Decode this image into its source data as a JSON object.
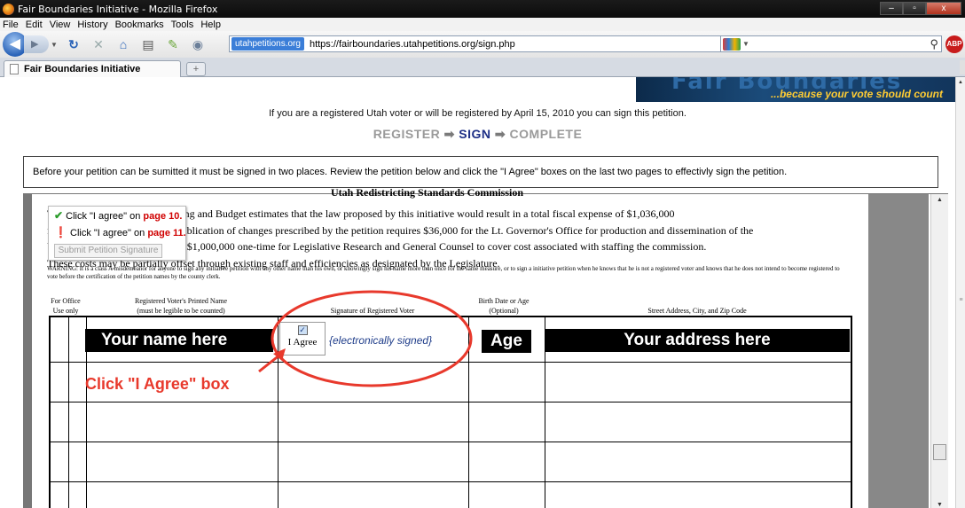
{
  "window": {
    "title": "Fair Boundaries Initiative - Mozilla Firefox",
    "buttons": {
      "minimize": "–",
      "maximize": "▫",
      "close": "x"
    }
  },
  "menu": [
    "File",
    "Edit",
    "View",
    "History",
    "Bookmarks",
    "Tools",
    "Help"
  ],
  "toolbar": {
    "site_badge": "utahpetitions.org",
    "url": "https://fairboundaries.utahpetitions.org/sign.php",
    "icons": [
      "back-icon",
      "forward-icon",
      "reload-icon",
      "stop-icon",
      "home-icon",
      "print-icon",
      "bookmark-icon",
      "addon-icon"
    ],
    "abp_label": "ABP"
  },
  "tabs": [
    {
      "label": "Fair Boundaries Initiative"
    }
  ],
  "page": {
    "banner_tagline": "...because your vote should count",
    "intro": "If you are a registered Utah voter or will be registered by April 15, 2010 you can sign this petition.",
    "steps": {
      "register": "REGISTER",
      "sign": "SIGN",
      "complete": "COMPLETE"
    },
    "notice": "Before your petition can be sumitted it must be signed in two places. Review the petition below and click the \"I Agree\" boxes on the last two pages to effectivly sign the petition."
  },
  "petition": {
    "heading_clip": "Utah Redistricting Standards Commission",
    "fiscal_lines": [
      "The Governor's Office of Planning and Budget estimates that the law proposed by this initiative would result in a total fiscal expense of $1,036,000",
      "for the cost of an election and publication of changes prescribed by the petition requires $36,000 for the Lt. Governor's Office for production and dissemination of the",
      "Voter Information Pamphlet and $1,000,000 one-time for Legislative Research and General Counsel to cover cost associated with staffing the commission.",
      "These costs may be partially offset through existing staff and efficiencies as designated by the Legislature."
    ],
    "warning": "WARNING: It is a class A misdemeanor for anyone to sign any initiative petition with any other name than his own, or knowingly sign his name more than once for the same measure, or to sign a initiative petition when he knows that he is not a registered voter and knows that he does not intend to become registered to vote before the certification of the petition names by the county clerk.",
    "helper": {
      "line1_prefix": "Click \"I agree\" on ",
      "line1_page": "page 10.",
      "line2_prefix": "Click \"I agree\" on ",
      "line2_page": "page 11.",
      "submit": "Submit Petition Signature"
    },
    "columns": {
      "office": "For Office\nUse only",
      "name": "Registered Voter's Printed Name\n(must be legible to be counted)",
      "signature": "Signature of Registered Voter",
      "birth": "Birth Date or Age\n(Optional)",
      "address": "Street Address, City, and Zip Code"
    },
    "row": {
      "name_placeholder": "Your name here",
      "agree_label": "I Agree",
      "esigned": "{electronically signed}",
      "age_placeholder": "Age",
      "address_placeholder": "Your address here"
    },
    "callout": "Click \"I Agree\" box"
  },
  "colors": {
    "accent_red": "#e8392c",
    "step_active": "#1d2f86",
    "banner_tagline": "#ffcc33"
  }
}
